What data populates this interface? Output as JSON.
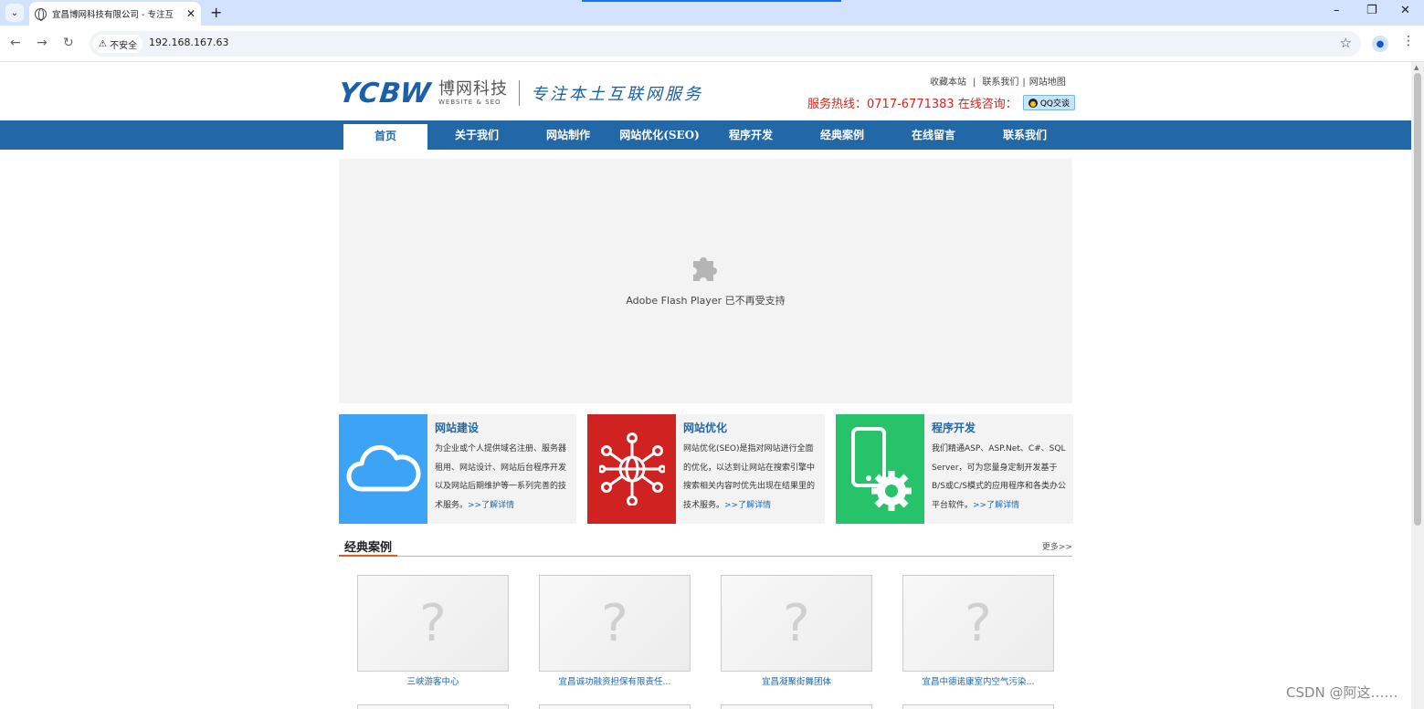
{
  "browser": {
    "tab_title": "宜昌博网科技有限公司 - 专注互",
    "security_label": "不安全",
    "url": "192.168.167.63"
  },
  "header": {
    "logo_mark": "YCBW",
    "logo_cn": "博网科技",
    "logo_en": "WEBSITE & SEO",
    "slogan": "专注本土互联网服务",
    "toplinks": [
      "收藏本站",
      "联系我们",
      "网站地图"
    ],
    "hotline_label": "服务热线：0717-6771383 在线咨询：",
    "qq_label": "QQ交谈"
  },
  "nav": {
    "items": [
      "首页",
      "关于我们",
      "网站制作",
      "网站优化(SEO)",
      "程序开发",
      "经典案例",
      "在线留言",
      "联系我们"
    ]
  },
  "banner": {
    "message": "Adobe Flash Player 已不再受支持"
  },
  "services": [
    {
      "title": "网站建设",
      "desc": "为企业或个人提供域名注册、服务器租用、网站设计、网站后台程序开发以及网站后期维护等一系列完善的技术服务。",
      "more": ">>了解详情",
      "color": "#3da3f5",
      "icon": "cloud-icon"
    },
    {
      "title": "网站优化",
      "desc": "网站优化(SEO)是指对网站进行全面的优化，以达到让网站在搜索引擎中搜索相关内容时优先出现在结果里的技术服务。",
      "more": ">>了解详情",
      "color": "#d12222",
      "icon": "network-globe-icon"
    },
    {
      "title": "程序开发",
      "desc": "我们精通ASP、ASP.Net、C#、SQL Server，可为您量身定制开发基于B/S或C/S模式的应用程序和各类办公平台软件。",
      "more": ">>了解详情",
      "color": "#27c36b",
      "icon": "phone-gear-icon"
    }
  ],
  "cases": {
    "title": "经典案例",
    "more": "更多>>",
    "items": [
      "三峡游客中心",
      "宜昌诚功融资担保有限责任...",
      "宜昌凝聚街舞团体",
      "宜昌中德诺康室内空气污染..."
    ]
  },
  "watermark": "CSDN @阿这……"
}
